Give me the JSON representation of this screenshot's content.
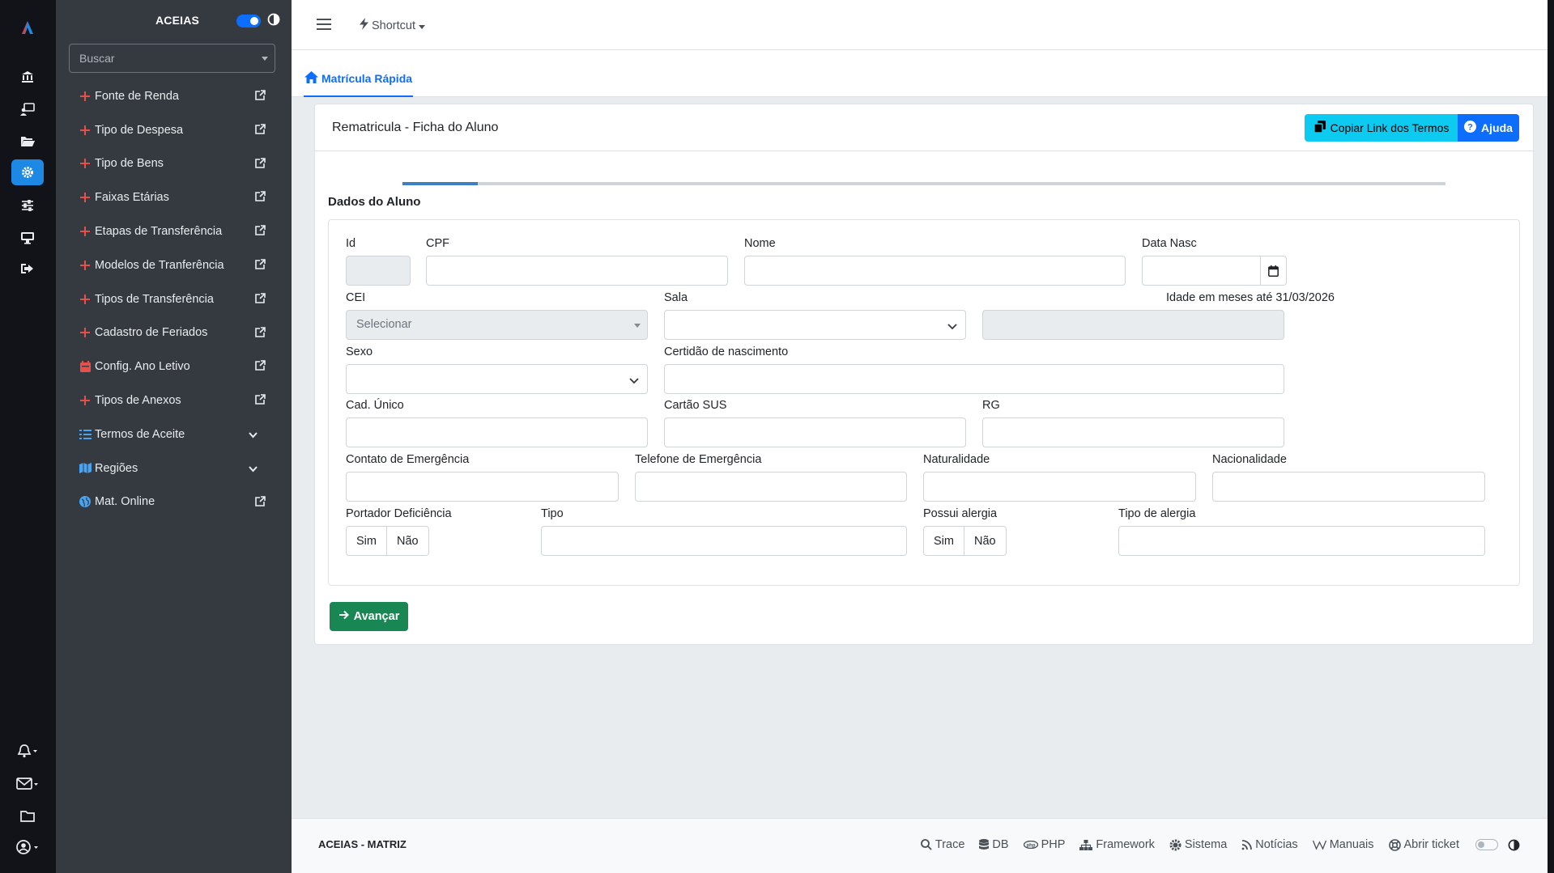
{
  "sidebar": {
    "brand": "ACEIAS",
    "search_placeholder": "Buscar",
    "items": [
      {
        "label": "Fonte de Renda"
      },
      {
        "label": "Tipo de Despesa"
      },
      {
        "label": "Tipo de Bens"
      },
      {
        "label": "Faixas Etárias"
      },
      {
        "label": "Etapas de Transferência"
      },
      {
        "label": "Modelos de Tranferência"
      },
      {
        "label": "Tipos de Transferência"
      },
      {
        "label": "Cadastro de Feriados"
      },
      {
        "label": "Config. Ano Letivo"
      },
      {
        "label": "Tipos de Anexos"
      },
      {
        "label": "Termos de Aceite"
      },
      {
        "label": "Regiões"
      },
      {
        "label": "Mat. Online"
      }
    ]
  },
  "topbar": {
    "shortcut": "Shortcut"
  },
  "tab": {
    "label": "Matrícula Rápida"
  },
  "card": {
    "title": "Rematricula - Ficha do Aluno",
    "copy_label": "Copiar Link dos Termos",
    "help_label": "Ajuda",
    "progress_fraction": 0.072,
    "section_title": "Dados do Aluno",
    "next_label": "Avançar"
  },
  "form": {
    "id": "Id",
    "cpf": "CPF",
    "nome": "Nome",
    "data_nasc": "Data Nasc",
    "cei": "CEI",
    "cei_placeholder": "Selecionar",
    "sala": "Sala",
    "idade": "Idade em meses até 31/03/2026",
    "sexo": "Sexo",
    "certidao": "Certidão de nascimento",
    "cad_unico": "Cad. Único",
    "cartao_sus": "Cartão SUS",
    "rg": "RG",
    "contato": "Contato de Emergência",
    "telefone": "Telefone de Emergência",
    "naturalidade": "Naturalidade",
    "nacionalidade": "Nacionalidade",
    "portador": "Portador Deficiência",
    "tipo": "Tipo",
    "alergia": "Possui alergia",
    "tipo_alergia": "Tipo de alergia",
    "sim": "Sim",
    "nao": "Não"
  },
  "footer": {
    "brand": "ACEIAS - MATRIZ",
    "links": [
      "Trace",
      "DB",
      "PHP",
      "Framework",
      "Sistema",
      "Notícias",
      "Manuais",
      "Abrir ticket"
    ]
  },
  "colors": {
    "accent": "#0d6efd",
    "info": "#0dcaf0",
    "success": "#198754",
    "sidebar": "#343a40",
    "rail": "#111318"
  }
}
